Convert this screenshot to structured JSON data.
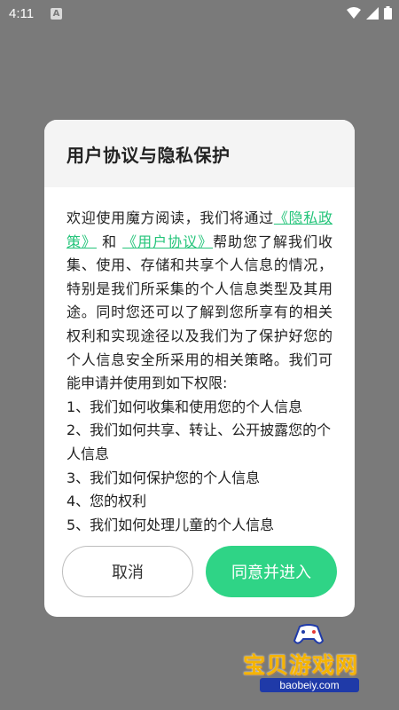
{
  "status_bar": {
    "time": "4:11",
    "notification_icon": "a-badge-icon",
    "icons": [
      "wifi-icon",
      "signal-icon",
      "battery-icon"
    ]
  },
  "dialog": {
    "title": "用户协议与隐私保护",
    "body": {
      "intro_1": "欢迎使用魔方阅读，我们将通过",
      "link_privacy": "《隐私政策》",
      "and": "和",
      "link_user": "《用户协议》",
      "intro_2": "帮助您了解我们收集、使用、存储和共享个人信息的情况，特别是我们所采集的个人信息类型及其用途。同时您还可以了解到您所享有的相关权利和实现途径以及我们为了保护好您的个人信息安全所采用的相关策略。我们可能申请并使用到如下权限:",
      "items": [
        "1、我们如何收集和使用您的个人信息",
        "2、我们如何共享、转让、公开披露您的个人信息",
        "3、我们如何保护您的个人信息",
        "4、您的权利",
        "5、我们如何处理儿童的个人信息"
      ]
    },
    "cancel_label": "取消",
    "agree_label": "同意并进入"
  },
  "watermark": {
    "text": "宝贝游戏网",
    "url": "baobeiy.com"
  },
  "colors": {
    "overlay": "#7a7a7a",
    "accent": "#2fd486",
    "link": "#24c47a",
    "watermark": "#f5b400"
  }
}
